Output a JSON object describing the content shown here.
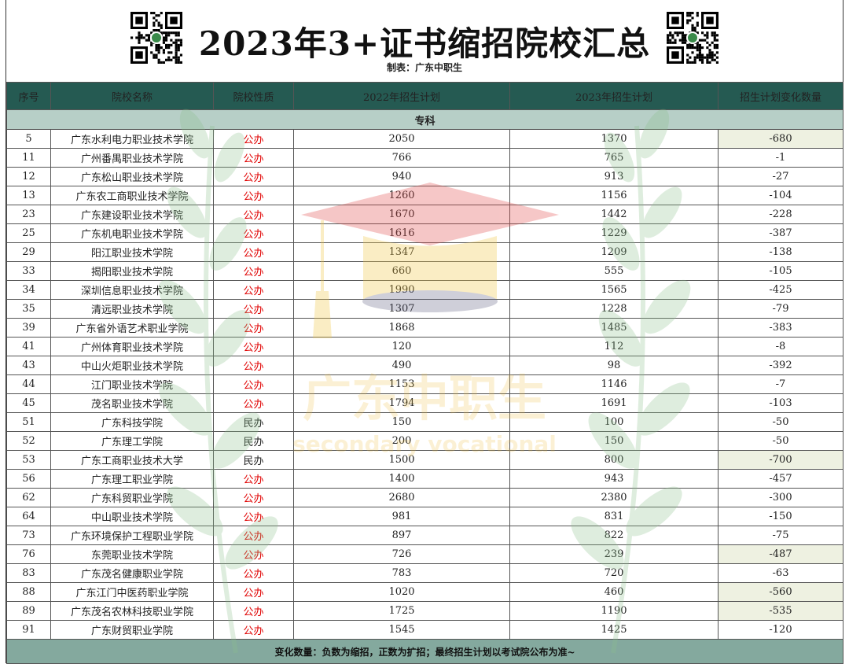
{
  "title": "2023年3+证书缩招院校汇总",
  "maker": "制表：广东中职生",
  "watermark": {
    "brand": "广东中职生",
    "subtitle": "secondary vocational"
  },
  "columns": [
    "序号",
    "院校名称",
    "院校性质",
    "2022年招生计划",
    "2023年招生计划",
    "招生计划变化数量"
  ],
  "section": "专科",
  "rows": [
    {
      "no": "5",
      "name": "广东水利电力职业技术学院",
      "nature": "公办",
      "y2022": "2050",
      "y2023": "1370",
      "change": "-680",
      "highlight": true
    },
    {
      "no": "11",
      "name": "广州番禺职业技术学院",
      "nature": "公办",
      "y2022": "766",
      "y2023": "765",
      "change": "-1",
      "highlight": false
    },
    {
      "no": "12",
      "name": "广东松山职业技术学院",
      "nature": "公办",
      "y2022": "940",
      "y2023": "913",
      "change": "-27",
      "highlight": false
    },
    {
      "no": "13",
      "name": "广东农工商职业技术学院",
      "nature": "公办",
      "y2022": "1260",
      "y2023": "1156",
      "change": "-104",
      "highlight": false
    },
    {
      "no": "23",
      "name": "广东建设职业技术学院",
      "nature": "公办",
      "y2022": "1670",
      "y2023": "1442",
      "change": "-228",
      "highlight": false
    },
    {
      "no": "25",
      "name": "广东机电职业技术学院",
      "nature": "公办",
      "y2022": "1616",
      "y2023": "1229",
      "change": "-387",
      "highlight": false
    },
    {
      "no": "29",
      "name": "阳江职业技术学院",
      "nature": "公办",
      "y2022": "1347",
      "y2023": "1209",
      "change": "-138",
      "highlight": false
    },
    {
      "no": "33",
      "name": "揭阳职业技术学院",
      "nature": "公办",
      "y2022": "660",
      "y2023": "555",
      "change": "-105",
      "highlight": false
    },
    {
      "no": "34",
      "name": "深圳信息职业技术学院",
      "nature": "公办",
      "y2022": "1990",
      "y2023": "1565",
      "change": "-425",
      "highlight": false
    },
    {
      "no": "35",
      "name": "清远职业技术学院",
      "nature": "公办",
      "y2022": "1307",
      "y2023": "1228",
      "change": "-79",
      "highlight": false
    },
    {
      "no": "39",
      "name": "广东省外语艺术职业学院",
      "nature": "公办",
      "y2022": "1868",
      "y2023": "1485",
      "change": "-383",
      "highlight": false
    },
    {
      "no": "41",
      "name": "广州体育职业技术学院",
      "nature": "公办",
      "y2022": "120",
      "y2023": "112",
      "change": "-8",
      "highlight": false
    },
    {
      "no": "43",
      "name": "中山火炬职业技术学院",
      "nature": "公办",
      "y2022": "490",
      "y2023": "98",
      "change": "-392",
      "highlight": false
    },
    {
      "no": "44",
      "name": "江门职业技术学院",
      "nature": "公办",
      "y2022": "1153",
      "y2023": "1146",
      "change": "-7",
      "highlight": false
    },
    {
      "no": "45",
      "name": "茂名职业技术学院",
      "nature": "公办",
      "y2022": "1794",
      "y2023": "1691",
      "change": "-103",
      "highlight": false
    },
    {
      "no": "51",
      "name": "广东科技学院",
      "nature": "民办",
      "y2022": "150",
      "y2023": "100",
      "change": "-50",
      "highlight": false
    },
    {
      "no": "52",
      "name": "广东理工学院",
      "nature": "民办",
      "y2022": "200",
      "y2023": "150",
      "change": "-50",
      "highlight": false
    },
    {
      "no": "53",
      "name": "广东工商职业技术大学",
      "nature": "民办",
      "y2022": "1500",
      "y2023": "800",
      "change": "-700",
      "highlight": true
    },
    {
      "no": "56",
      "name": "广东理工职业学院",
      "nature": "公办",
      "y2022": "1400",
      "y2023": "943",
      "change": "-457",
      "highlight": false
    },
    {
      "no": "62",
      "name": "广东科贸职业学院",
      "nature": "公办",
      "y2022": "2680",
      "y2023": "2380",
      "change": "-300",
      "highlight": false
    },
    {
      "no": "64",
      "name": "中山职业技术学院",
      "nature": "公办",
      "y2022": "981",
      "y2023": "831",
      "change": "-150",
      "highlight": false
    },
    {
      "no": "73",
      "name": "广东环境保护工程职业学院",
      "nature": "公办",
      "y2022": "897",
      "y2023": "822",
      "change": "-75",
      "highlight": false
    },
    {
      "no": "76",
      "name": "东莞职业技术学院",
      "nature": "公办",
      "y2022": "726",
      "y2023": "239",
      "change": "-487",
      "highlight": true
    },
    {
      "no": "83",
      "name": "广东茂名健康职业学院",
      "nature": "公办",
      "y2022": "783",
      "y2023": "720",
      "change": "-63",
      "highlight": false
    },
    {
      "no": "88",
      "name": "广东江门中医药职业学院",
      "nature": "公办",
      "y2022": "1020",
      "y2023": "460",
      "change": "-560",
      "highlight": true
    },
    {
      "no": "89",
      "name": "广东茂名农林科技职业学院",
      "nature": "公办",
      "y2022": "1725",
      "y2023": "1190",
      "change": "-535",
      "highlight": true
    },
    {
      "no": "91",
      "name": "广东财贸职业学院",
      "nature": "公办",
      "y2022": "1545",
      "y2023": "1425",
      "change": "-120",
      "highlight": false
    }
  ],
  "footer": "变化数量：负数为缩招，正数为扩招；最终招生计划以考试院公布为准~",
  "colors": {
    "header_bg": "#255a52",
    "section_bg": "#b7cfc7",
    "footer_bg": "#84a99e",
    "public_text": "#e00000",
    "change_text": "#e00000",
    "highlight_bg": "#eef1e1"
  }
}
